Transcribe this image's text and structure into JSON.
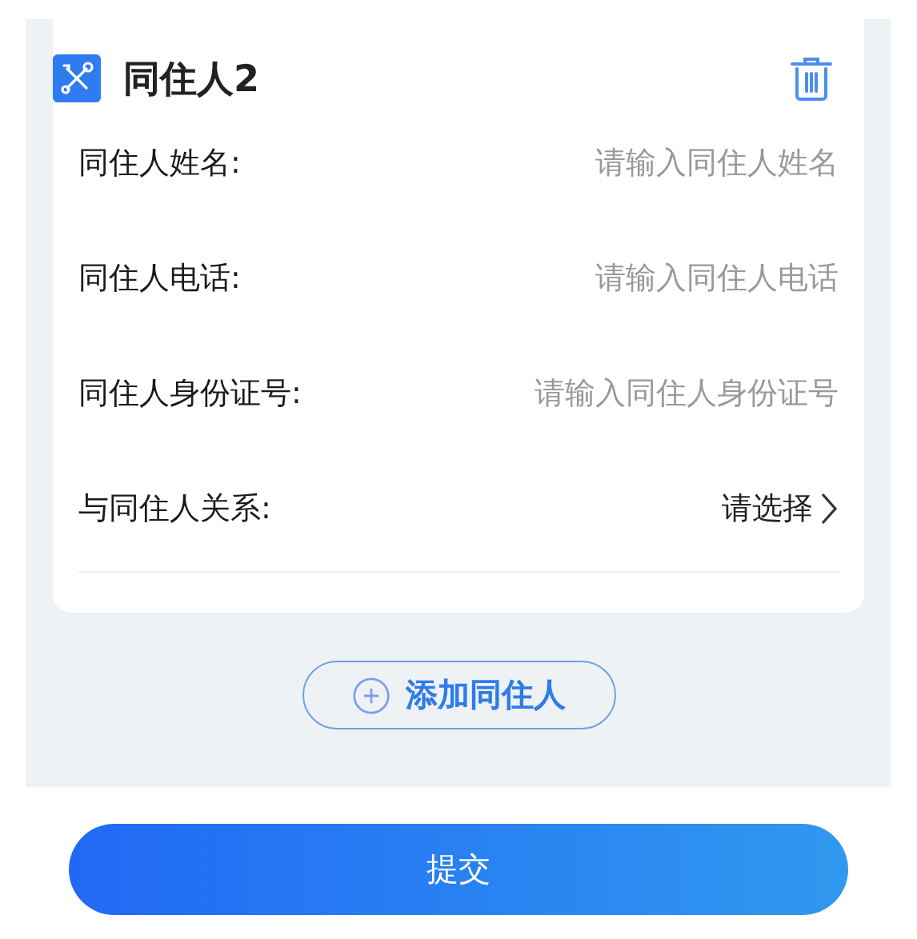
{
  "card": {
    "title": "同住人2",
    "fields": [
      {
        "kind": "input",
        "label": "同住人姓名:",
        "placeholder": "请输入同住人姓名"
      },
      {
        "kind": "input",
        "label": "同住人电话:",
        "placeholder": "请输入同住人电话"
      },
      {
        "kind": "input",
        "label": "同住人身份证号:",
        "placeholder": "请输入同住人身份证号"
      },
      {
        "kind": "select",
        "label": "与同住人关系:",
        "value": "请选择"
      }
    ]
  },
  "add_button": "添加同住人",
  "submit_button": "提交"
}
